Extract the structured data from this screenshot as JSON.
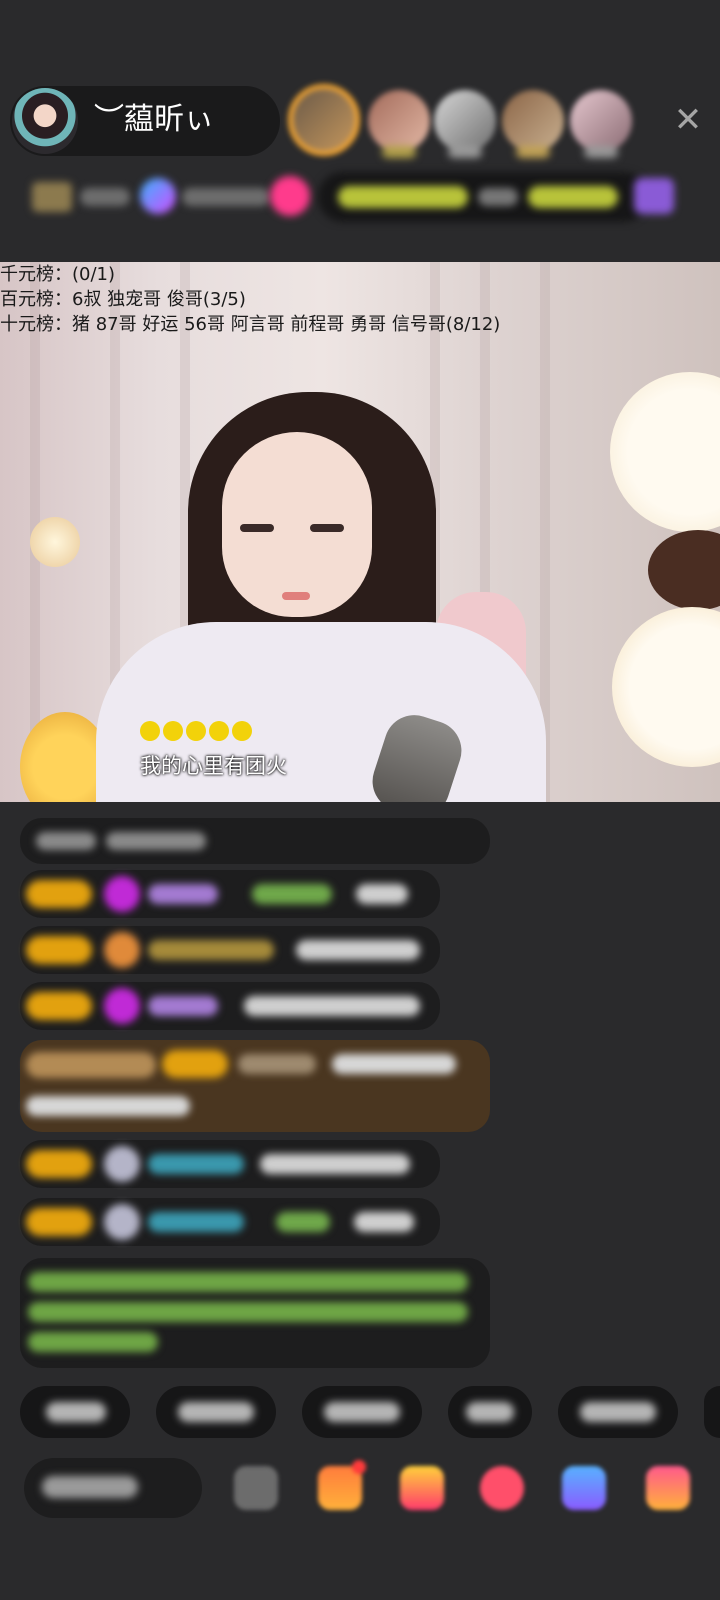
{
  "host": {
    "name": "︶藴昕ぃ"
  },
  "viewers": {
    "count_shown": 5,
    "close_label": "✕"
  },
  "video": {
    "rank_lines": [
      "千元榜：(0/1)",
      "百元榜：6叔 独宠哥 俊哥(3/5)",
      "十元榜：猪 87哥 好运 56哥 阿言哥 前程哥 勇哥 信号哥(8/12)"
    ],
    "lyric": "我的心里有团火",
    "lyric_dots": 5
  },
  "colors": {
    "background": "#2a2a2c",
    "bubble": "#1d1d1e",
    "accent_gold": "#f2a533",
    "lyric_dot": "#f2d20a"
  }
}
